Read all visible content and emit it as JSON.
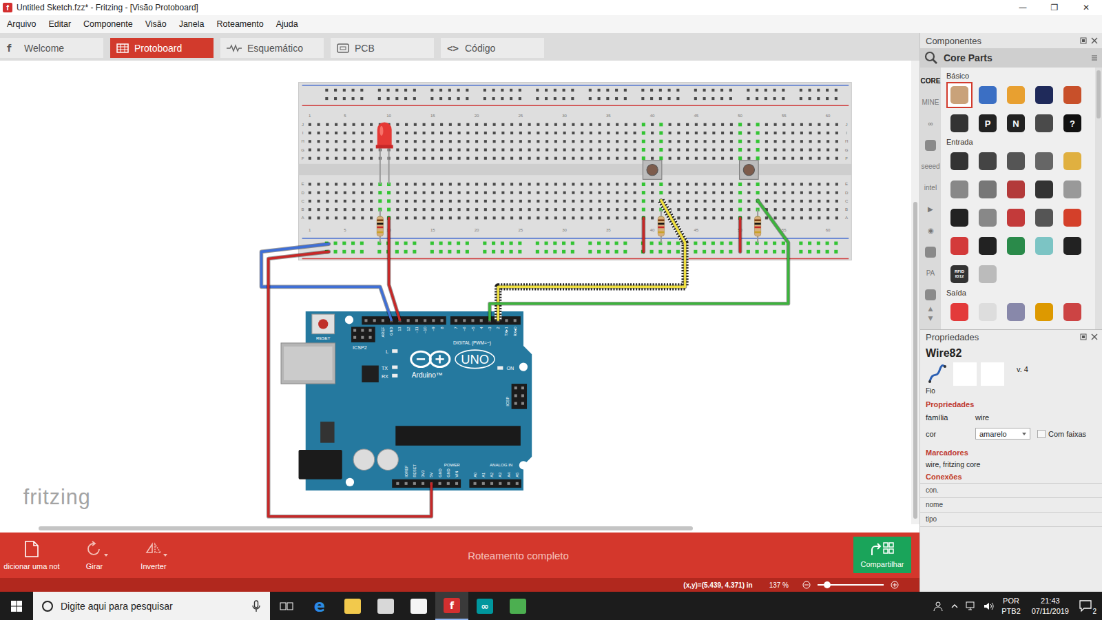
{
  "window": {
    "app_glyph": "f",
    "title": "Untitled Sketch.fzz* - Fritzing - [Visão Protoboard]",
    "controls": [
      "—",
      "❐",
      "✕"
    ]
  },
  "menu": [
    "Arquivo",
    "Editar",
    "Componente",
    "Visão",
    "Janela",
    "Roteamento",
    "Ajuda"
  ],
  "tabs": [
    {
      "label": "Welcome",
      "glyph": "f",
      "selected": false
    },
    {
      "label": "Protoboard",
      "glyph": "",
      "selected": true
    },
    {
      "label": "Esquemático",
      "glyph": "",
      "selected": false
    },
    {
      "label": "PCB",
      "glyph": "",
      "selected": false
    },
    {
      "label": "Código",
      "glyph": "<>",
      "selected": false
    }
  ],
  "canvas": {
    "logo": "fritzing",
    "breadboard": {
      "columns": [
        "1",
        "5",
        "10",
        "15",
        "20",
        "25",
        "30",
        "35",
        "40",
        "45",
        "50",
        "55",
        "60"
      ],
      "rows_top": [
        "J",
        "I",
        "H",
        "G",
        "F"
      ],
      "rows_bottom": [
        "E",
        "D",
        "C",
        "B",
        "A"
      ],
      "highlighted": [
        {
          "col": 8,
          "top": false,
          "bottom": true
        },
        {
          "col": 9,
          "top": false,
          "bottom": true
        },
        {
          "col": 38,
          "top": true,
          "bottom": true
        },
        {
          "col": 40,
          "top": true,
          "bottom": true
        },
        {
          "col": 49,
          "top": true,
          "bottom": true
        },
        {
          "col": 51,
          "top": true,
          "bottom": true
        }
      ],
      "rail_top_highlighted": false,
      "rail_bottom_highlighted": true
    },
    "wires": [
      {
        "color": "#3f6fd6",
        "selected": false
      },
      {
        "color": "#c62828",
        "selected": false
      },
      {
        "color": "#c62828",
        "selected": false
      },
      {
        "color": "#c62828",
        "selected": false
      },
      {
        "color": "#c62828",
        "selected": false
      },
      {
        "color": "#f0e040",
        "selected": true
      },
      {
        "color": "#3cb43c",
        "selected": false
      }
    ],
    "arduino": {
      "model": "UNO",
      "brand": "Arduino™",
      "reset": "RESET",
      "icsp2": "ICSP2",
      "icsp": "ICSP",
      "digital": "DIGITAL (PWM=~)",
      "tx": "TX",
      "rx": "RX",
      "l": "L",
      "on": "ON",
      "power": "POWER",
      "analog": "ANALOG IN",
      "digital_pins": [
        "AREF",
        "GND",
        "13",
        "12",
        "~11",
        "~10",
        "~9",
        "8",
        "7",
        "~6",
        "~5",
        "4",
        "~3",
        "2",
        "TX▸1",
        "RX◂0"
      ],
      "power_pins": [
        "IOREF",
        "RESET",
        "3V3",
        "5V",
        "GND",
        "GND",
        "VIN"
      ],
      "analog_pins": [
        "A0",
        "A1",
        "A2",
        "A3",
        "A4",
        "A5"
      ]
    }
  },
  "parts_panel": {
    "title": "Componentes",
    "search_label": "Core Parts",
    "bins": [
      {
        "label": "CORE",
        "selected": true
      },
      {
        "label": "MINE",
        "selected": false
      },
      {
        "label": "∞",
        "selected": false
      },
      {
        "label": "",
        "selected": false
      },
      {
        "label": "seeed",
        "selected": false
      },
      {
        "label": "intel",
        "selected": false
      },
      {
        "label": "▶",
        "selected": false
      },
      {
        "label": "◉",
        "selected": false
      },
      {
        "label": "",
        "selected": false
      },
      {
        "label": "PA",
        "selected": false
      },
      {
        "label": "",
        "selected": false
      }
    ],
    "bin_scroll": [
      "▲",
      "▼"
    ],
    "sections": [
      {
        "label": "Básico",
        "parts": [
          {
            "color": "#c9a27a",
            "glyph": "",
            "selected": true
          },
          {
            "color": "#3b6fc4",
            "glyph": "",
            "selected": false
          },
          {
            "color": "#e8a030",
            "glyph": "",
            "selected": false
          },
          {
            "color": "#1f2a5a",
            "glyph": "",
            "selected": false
          },
          {
            "color": "#c8502a",
            "glyph": "",
            "selected": false
          },
          {
            "color": "#333333",
            "glyph": "",
            "selected": false
          },
          {
            "color": "#222222",
            "glyph": "P",
            "selected": false
          },
          {
            "color": "#222222",
            "glyph": "N",
            "selected": false
          },
          {
            "color": "#4a4a4a",
            "glyph": "",
            "selected": false
          },
          {
            "color": "#111111",
            "glyph": "?",
            "selected": false
          }
        ]
      },
      {
        "label": "Entrada",
        "parts": [
          {
            "color": "#333333",
            "glyph": "",
            "selected": false
          },
          {
            "color": "#444444",
            "glyph": "",
            "selected": false
          },
          {
            "color": "#555555",
            "glyph": "",
            "selected": false
          },
          {
            "color": "#666666",
            "glyph": "",
            "selected": false
          },
          {
            "color": "#e0b040",
            "glyph": "",
            "selected": false
          },
          {
            "color": "#888888",
            "glyph": "",
            "selected": false
          },
          {
            "color": "#777777",
            "glyph": "",
            "selected": false
          },
          {
            "color": "#b33a3a",
            "glyph": "",
            "selected": false
          },
          {
            "color": "#333333",
            "glyph": "",
            "selected": false
          },
          {
            "color": "#999999",
            "glyph": "",
            "selected": false
          },
          {
            "color": "#222222",
            "glyph": "",
            "selected": false
          },
          {
            "color": "#888888",
            "glyph": "",
            "selected": false
          },
          {
            "color": "#c33a3a",
            "glyph": "",
            "selected": false
          },
          {
            "color": "#555555",
            "glyph": "",
            "selected": false
          },
          {
            "color": "#d4402a",
            "glyph": "",
            "selected": false
          },
          {
            "color": "#d33a3a",
            "glyph": "",
            "selected": false
          },
          {
            "color": "#222222",
            "glyph": "",
            "selected": false
          },
          {
            "color": "#2a8a4a",
            "glyph": "",
            "selected": false
          },
          {
            "color": "#7cc4c4",
            "glyph": "",
            "selected": false
          },
          {
            "color": "#222222",
            "glyph": "",
            "selected": false
          },
          {
            "color": "#333333",
            "glyph": "RFID ID12",
            "selected": false
          },
          {
            "color": "#bbbbbb",
            "glyph": "",
            "selected": false
          }
        ]
      },
      {
        "label": "Saída",
        "parts": [
          {
            "color": "#e33a3a",
            "glyph": "",
            "selected": false
          },
          {
            "color": "#dddddd",
            "glyph": "",
            "selected": false
          },
          {
            "color": "#8888aa",
            "glyph": "",
            "selected": false
          },
          {
            "color": "#dd9900",
            "glyph": "",
            "selected": false
          },
          {
            "color": "#cc4444",
            "glyph": "",
            "selected": false
          }
        ]
      }
    ]
  },
  "properties": {
    "title": "Propriedades",
    "name": "Wire82",
    "icon_caption": "Fio",
    "version": "v. 4",
    "section_title": "Propriedades",
    "rows": [
      {
        "kind": "text",
        "label": "família",
        "value": "wire",
        "checkbox_label": "",
        "checked": false
      },
      {
        "kind": "select",
        "label": "cor",
        "value": "amarelo",
        "checkbox_label": "Com faixas",
        "checked": false
      }
    ],
    "tags_title": "Marcadores",
    "tags": "wire, fritzing core",
    "connections_title": "Conexões",
    "connections": [
      "con.",
      "nome",
      "tipo"
    ]
  },
  "toolbar": {
    "tools": [
      {
        "label": "dicionar uma not",
        "has_menu": false
      },
      {
        "label": "Girar",
        "has_menu": true
      },
      {
        "label": "Inverter",
        "has_menu": true
      }
    ],
    "message": "Roteamento completo",
    "share": "Compartilhar"
  },
  "status": {
    "coords": "(x,y)=(5.439, 4.371) in",
    "zoom": "137 %",
    "zoom_level": 0.15
  },
  "taskbar": {
    "search_placeholder": "Digite aqui para pesquisar",
    "apps": [
      {
        "kind": "glyph",
        "glyph": "e",
        "color": "#2b8ce6",
        "active": false
      },
      {
        "kind": "tile",
        "glyph": "",
        "color": "#f2c94c",
        "active": false
      },
      {
        "kind": "tile",
        "glyph": "",
        "color": "#d8d8d8",
        "active": false
      },
      {
        "kind": "tile",
        "glyph": "",
        "color": "#f5f5f5",
        "active": false
      },
      {
        "kind": "tile",
        "glyph": "f",
        "color": "#d32f2f",
        "active": true
      },
      {
        "kind": "tile",
        "glyph": "∞",
        "color": "#00979d",
        "active": false
      },
      {
        "kind": "tile",
        "glyph": "",
        "color": "#4caf50",
        "active": false
      }
    ],
    "lang": [
      "POR",
      "PTB2"
    ],
    "time": "21:43",
    "date": "07/11/2019",
    "notifications": "2"
  }
}
